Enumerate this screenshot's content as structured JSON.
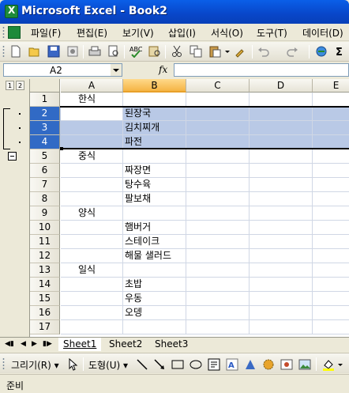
{
  "window": {
    "title": "Microsoft Excel - Book2"
  },
  "menu": [
    "파일(F)",
    "편집(E)",
    "보기(V)",
    "삽입(I)",
    "서식(O)",
    "도구(T)",
    "데이터(D)"
  ],
  "toolbar_icons": [
    "new-icon",
    "open-icon",
    "save-icon",
    "permission-icon",
    "print-icon",
    "print-preview-icon",
    "spelling-icon",
    "research-icon",
    "cut-icon",
    "copy-icon",
    "paste-icon",
    "format-painter-icon",
    "undo-icon",
    "redo-icon",
    "hyperlink-icon",
    "autosum-icon"
  ],
  "formula_bar": {
    "name_box": "A2",
    "fx_label": "fx",
    "formula": ""
  },
  "outline_levels": [
    "1",
    "2"
  ],
  "columns": [
    "A",
    "B",
    "C",
    "D",
    "E"
  ],
  "rows": [
    {
      "n": "1",
      "a": "한식",
      "b": ""
    },
    {
      "n": "2",
      "a": "",
      "b": "된장국"
    },
    {
      "n": "3",
      "a": "",
      "b": "김치찌개"
    },
    {
      "n": "4",
      "a": "",
      "b": "파전"
    },
    {
      "n": "5",
      "a": "중식",
      "b": ""
    },
    {
      "n": "6",
      "a": "",
      "b": "짜장면"
    },
    {
      "n": "7",
      "a": "",
      "b": "탕수육"
    },
    {
      "n": "8",
      "a": "",
      "b": "팔보채"
    },
    {
      "n": "9",
      "a": "양식",
      "b": ""
    },
    {
      "n": "10",
      "a": "",
      "b": "햄버거"
    },
    {
      "n": "11",
      "a": "",
      "b": "스테이크"
    },
    {
      "n": "12",
      "a": "",
      "b": "해물 샐러드"
    },
    {
      "n": "13",
      "a": "일식",
      "b": ""
    },
    {
      "n": "14",
      "a": "",
      "b": "초밥"
    },
    {
      "n": "15",
      "a": "",
      "b": "우동"
    },
    {
      "n": "16",
      "a": "",
      "b": "오뎅"
    },
    {
      "n": "17",
      "a": "",
      "b": ""
    }
  ],
  "sheet_tabs": [
    "Sheet1",
    "Sheet2",
    "Sheet3"
  ],
  "drawing_toolbar": {
    "draw_label": "그리기(R)",
    "autoshapes_label": "도형(U)"
  },
  "status": {
    "text": "준비"
  },
  "colors": {
    "title_bar": "#0846C9",
    "selection": "#B9C9E6",
    "active_header": "#F5B445",
    "excel_green": "#1E8A3A"
  }
}
